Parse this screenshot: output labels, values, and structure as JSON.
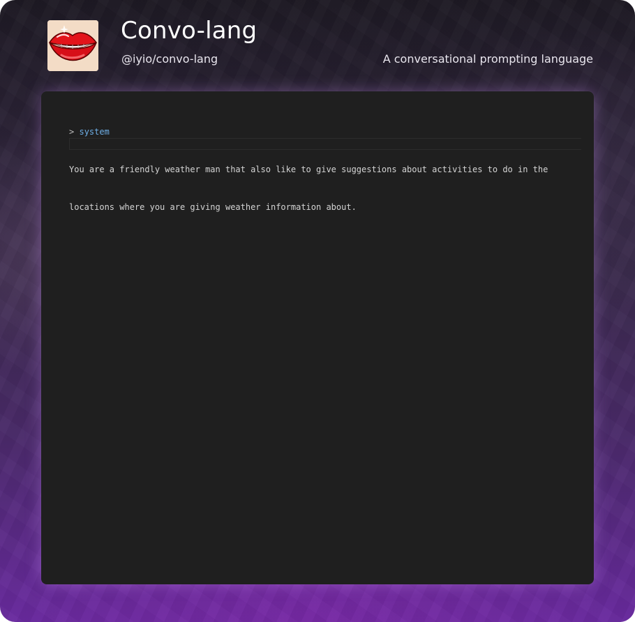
{
  "header": {
    "logo_icon": "red-lips-icon",
    "title": "Convo-lang",
    "handle": "@iyio/convo-lang",
    "tagline": "A conversational prompting language"
  },
  "editor": {
    "prompt_char": ">",
    "role": "system",
    "lines": [
      "You are a friendly weather man that also like to give suggestions about activities to do in the",
      "locations where you are giving weather information about."
    ]
  },
  "colors": {
    "editor_background": "#1f1f1f",
    "role_keyword": "#6fb0e8",
    "code_text": "#d4d4d4",
    "title_text": "#ffffff"
  }
}
